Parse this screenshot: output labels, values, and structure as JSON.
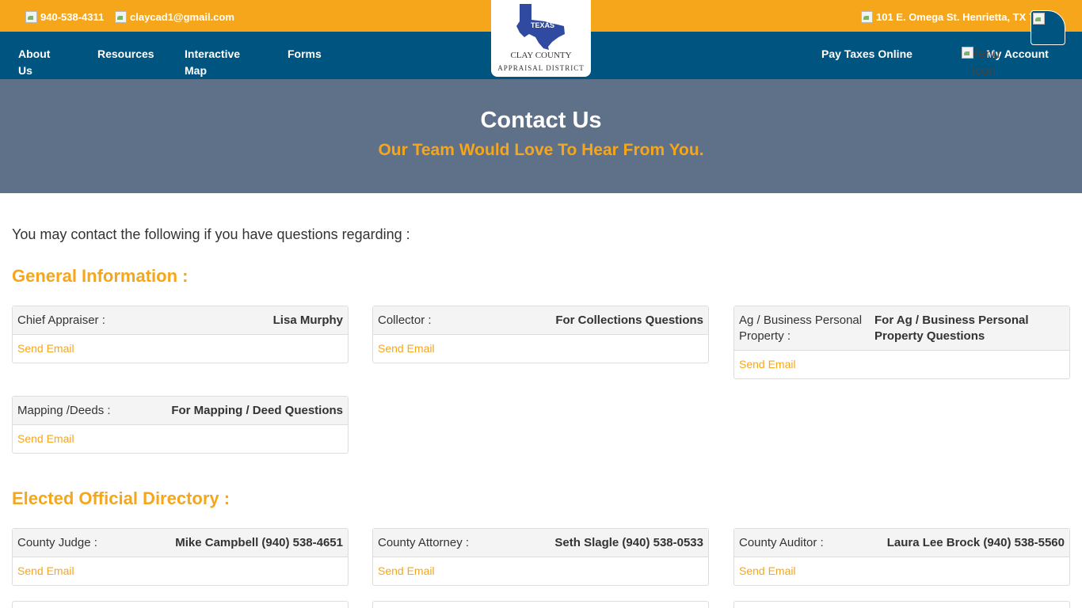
{
  "topbar": {
    "phone": "940-538-4311",
    "email": "claycad1@gmail.com",
    "address": "101 E. Omega St. Henrietta, TX 7"
  },
  "logo": {
    "state": "TEXAS",
    "line1": "CLAY COUNTY",
    "line2": "APPRAISAL DISTRICT"
  },
  "nav": {
    "about_1": "About",
    "about_2": "Us",
    "resources": "Resources",
    "map_1": "Interactive",
    "map_2": "Map",
    "forms": "Forms",
    "pay_taxes": "Pay Taxes Online",
    "my_account": "My Account",
    "menu_icon_1": "Menu",
    "menu_icon_2": "Icon"
  },
  "hero": {
    "title": "Contact Us",
    "subtitle": "Our Team Would Love To Hear From You."
  },
  "intro": "You may contact the following if you have questions regarding :",
  "general": {
    "title": "General Information :",
    "cards": [
      {
        "role": "Chief Appraiser :",
        "name": "Lisa Murphy",
        "link": "Send Email"
      },
      {
        "role": "Collector :",
        "name": "For Collections Questions",
        "link": "Send Email"
      },
      {
        "role": "Ag / Business Personal Property :",
        "name": "For Ag / Business Personal Property Questions",
        "link": "Send Email"
      },
      {
        "role": "Mapping /Deeds :",
        "name": "For Mapping / Deed Questions",
        "link": "Send Email"
      }
    ]
  },
  "elected": {
    "title": "Elected Official Directory :",
    "cards": [
      {
        "role": "County Judge :",
        "name": "Mike Campbell (940) 538-4651",
        "link": "Send Email"
      },
      {
        "role": "County Attorney :",
        "name": "Seth Slagle (940) 538-0533",
        "link": "Send Email"
      },
      {
        "role": "County Auditor :",
        "name": "Laura Lee Brock (940) 538-5560",
        "link": "Send Email"
      }
    ]
  },
  "colors": {
    "accent": "#f6a61b",
    "nav": "#005580",
    "hero": "#5f7189"
  }
}
